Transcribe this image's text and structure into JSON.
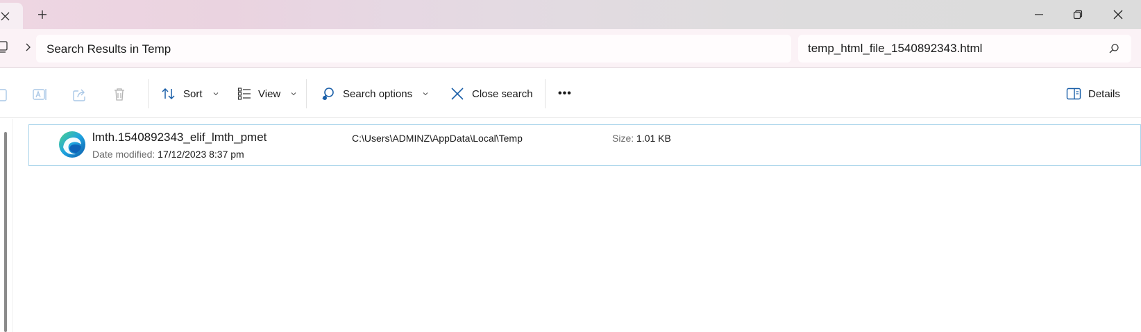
{
  "window": {
    "new_tab_label": "+"
  },
  "address_bar": {
    "path_text": "Search Results in Temp"
  },
  "search": {
    "value": "temp_html_file_1540892343.html"
  },
  "toolbar": {
    "sort_label": "Sort",
    "view_label": "View",
    "search_options_label": "Search options",
    "close_search_label": "Close search",
    "more_label": "•••",
    "details_label": "Details"
  },
  "results": [
    {
      "name": "lmth.1540892343_elif_lmth_pmet",
      "date_label": "Date modified:",
      "date_value": "17/12/2023 8:37 pm",
      "path": "C:\\Users\\ADMINZ\\AppData\\Local\\Temp",
      "size_label": "Size:",
      "size_value": "1.01 KB",
      "icon": "edge-browser-icon"
    }
  ],
  "colors": {
    "accent": "#0067c0",
    "selection_border": "#a7d3ea",
    "titlebar_tint": "#eed6e2"
  }
}
